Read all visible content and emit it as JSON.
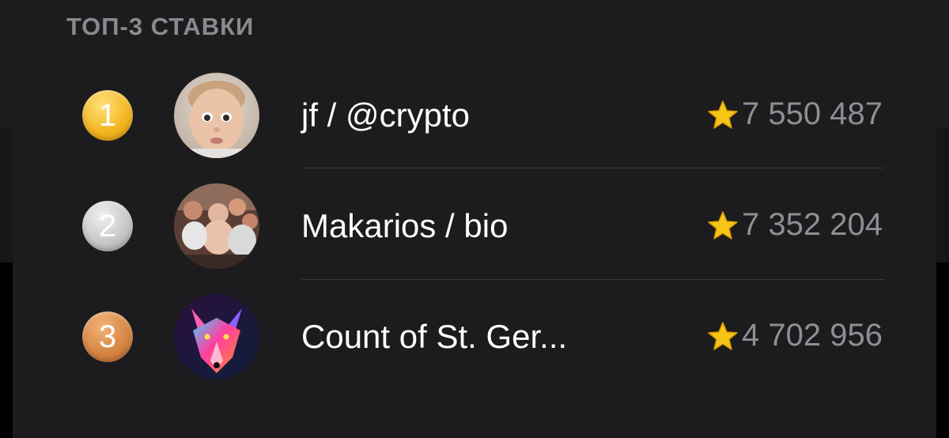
{
  "section": {
    "title": "ТОП-3 СТАВКИ"
  },
  "bets": [
    {
      "rank": "1",
      "name": "jf / @crypto",
      "amount": "7 550 487",
      "avatar": "child-portrait",
      "badge_color": "#f2b31d"
    },
    {
      "rank": "2",
      "name": "Makarios / bio",
      "amount": "7 352 204",
      "avatar": "group-photo",
      "badge_color": "#c4c4c4"
    },
    {
      "rank": "3",
      "name": "Count of St. Ger...",
      "amount": "4 702 956",
      "avatar": "neon-wolf",
      "badge_color": "#d48342"
    }
  ],
  "icons": {
    "currency": "star-icon"
  },
  "colors": {
    "background": "#1c1c1e",
    "text_primary": "#ffffff",
    "text_secondary": "#8e8e93",
    "star": "#f5c518"
  }
}
